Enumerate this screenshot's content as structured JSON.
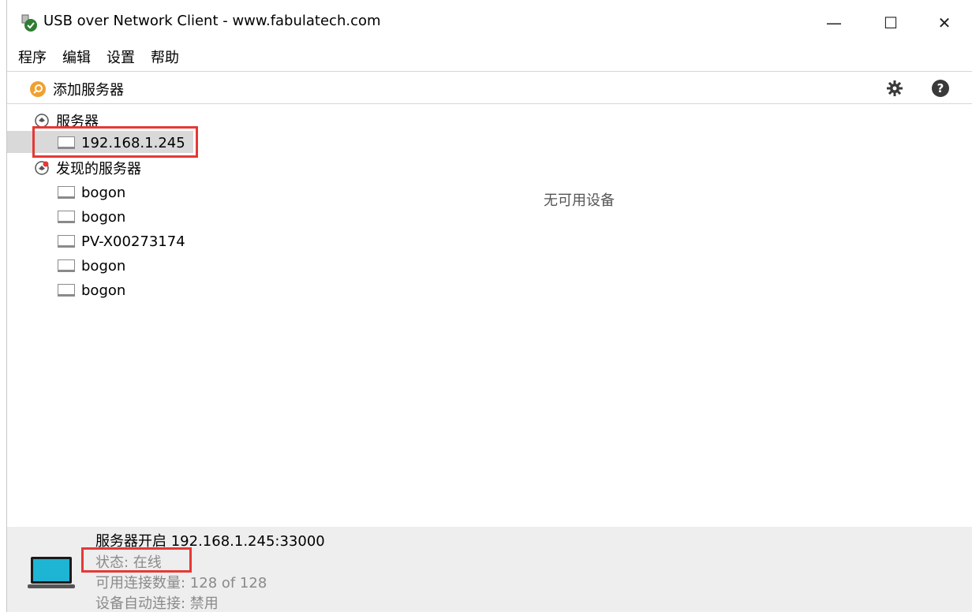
{
  "window": {
    "title": "USB over Network Client - www.fabulatech.com",
    "controls": {
      "minimize": "—",
      "maximize": "☐",
      "close": "✕"
    }
  },
  "menu": [
    "程序",
    "编辑",
    "设置",
    "帮助"
  ],
  "toolbar": {
    "add_server_label": "添加服务器",
    "add_server_icon": "search-icon",
    "settings_icon": "gear-icon",
    "help_icon": "help-icon",
    "help_glyph": "?"
  },
  "tree": {
    "servers_group": {
      "label": "服务器",
      "items": [
        {
          "label": "192.168.1.245",
          "selected": true
        }
      ]
    },
    "discovered_group": {
      "label": "发现的服务器",
      "items": [
        {
          "label": "bogon"
        },
        {
          "label": "bogon"
        },
        {
          "label": "PV-X00273174"
        },
        {
          "label": "bogon"
        },
        {
          "label": "bogon"
        }
      ]
    }
  },
  "main": {
    "empty_message": "无可用设备"
  },
  "status": {
    "title": "服务器开启 192.168.1.245:33000",
    "state": "状态: 在线",
    "connections": "可用连接数量: 128 of 128",
    "auto_connect": "设备自动连接: 禁用"
  },
  "colors": {
    "accent_orange": "#f0a030",
    "highlight_red": "#e53935",
    "selection_gray": "#d9d9d9",
    "status_bg": "#eeeeee"
  }
}
